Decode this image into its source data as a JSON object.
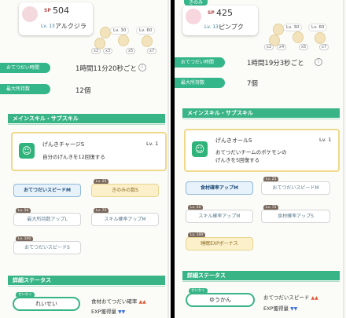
{
  "left": {
    "sp_label": "SP",
    "sp_value": "504",
    "lv_label": "Lv. 13",
    "pokemon_name": "アルクジラ",
    "level_pills": [
      "Lv. 30",
      "Lv. 60"
    ],
    "ingredient_counts": [
      "x2",
      "x3",
      "x5",
      "x7"
    ],
    "stats": [
      {
        "label": "おてつだい時間",
        "value": "1時間11分20秒ごと"
      },
      {
        "label": "最大所持数",
        "value": "12個"
      }
    ],
    "section_skill": "メインスキル・サブスキル",
    "main_skill": {
      "name": "げんきチャージS",
      "level": "Lv. 1",
      "desc": "自分のげんきを12回復する"
    },
    "subskills": [
      {
        "name": "おてつだいスピードM",
        "level": "",
        "style": "blue"
      },
      {
        "name": "きのみの数S",
        "level": "Lv. 25",
        "style": "gold"
      },
      {
        "name": "最大所持数アップL",
        "level": "Lv. 50",
        "style": "white"
      },
      {
        "name": "スキル確率アップM",
        "level": "Lv. 75",
        "style": "white"
      },
      {
        "name": "おてつだいスピードS",
        "level": "Lv. 100",
        "style": "white"
      }
    ],
    "section_detail": "詳細ステータス",
    "nature_tag": "せいかく",
    "nature": "れいせい",
    "nature_effects": [
      {
        "text": "食材おてつだい確率",
        "arrows": "▲▲",
        "dir": "up"
      },
      {
        "text": "EXP獲得量",
        "arrows": "▼▼",
        "dir": "down"
      }
    ]
  },
  "right": {
    "top_label": "きのみ",
    "sp_label": "SP",
    "sp_value": "425",
    "lv_label": "Lv. 13",
    "pokemon_name": "ピンプク",
    "level_pills": [
      "Lv. 30",
      "Lv. 60"
    ],
    "ingredient_counts": [
      "x2",
      "x4",
      "x5",
      "x7"
    ],
    "stats": [
      {
        "label": "おてつだい時間",
        "value": "1時間19分3秒ごと"
      },
      {
        "label": "最大所持数",
        "value": "7個"
      }
    ],
    "section_skill": "メインスキル・サブスキル",
    "main_skill": {
      "name": "げんきオールS",
      "level": "Lv. 1",
      "desc1": "おてつだいチームのポケモンの",
      "desc2": "げんきを5回復する"
    },
    "subskills": [
      {
        "name": "食材確率アップM",
        "level": "",
        "style": "blue"
      },
      {
        "name": "おてつだいスピードM",
        "level": "Lv. 25",
        "style": "white"
      },
      {
        "name": "スキル確率アップM",
        "level": "Lv. 50",
        "style": "white"
      },
      {
        "name": "食材確率アップS",
        "level": "Lv. 75",
        "style": "white"
      },
      {
        "name": "睡眠EXPボーナス",
        "level": "Lv. 100",
        "style": "gold"
      }
    ],
    "section_detail": "詳細ステータス",
    "nature_tag": "せいかく",
    "nature": "ゆうかん",
    "nature_effects": [
      {
        "text": "おてつだいスピード",
        "arrows": "▲▲",
        "dir": "up"
      },
      {
        "text": "EXP獲得量",
        "arrows": "▼▼",
        "dir": "down"
      }
    ]
  },
  "info_glyph": "i",
  "smile_glyph": "☺"
}
